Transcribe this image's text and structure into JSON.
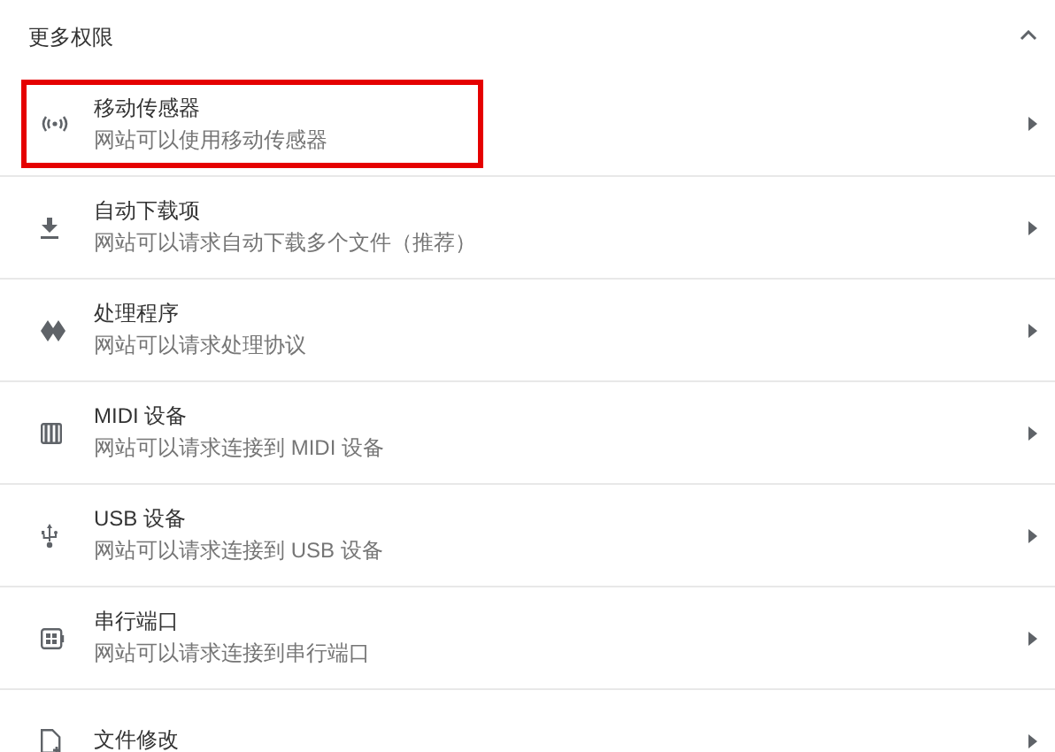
{
  "section": {
    "title": "更多权限",
    "expanded": true
  },
  "items": [
    {
      "kind": "sensors",
      "title": "移动传感器",
      "description": "网站可以使用移动传感器",
      "highlighted": true
    },
    {
      "kind": "download",
      "title": "自动下载项",
      "description": "网站可以请求自动下载多个文件（推荐）",
      "highlighted": false
    },
    {
      "kind": "handler",
      "title": "处理程序",
      "description": "网站可以请求处理协议",
      "highlighted": false
    },
    {
      "kind": "midi",
      "title": "MIDI 设备",
      "description": "网站可以请求连接到 MIDI 设备",
      "highlighted": false
    },
    {
      "kind": "usb",
      "title": "USB 设备",
      "description": "网站可以请求连接到 USB 设备",
      "highlighted": false
    },
    {
      "kind": "serial",
      "title": "串行端口",
      "description": "网站可以请求连接到串行端口",
      "highlighted": false
    },
    {
      "kind": "file",
      "title": "文件修改",
      "highlighted": false
    }
  ]
}
